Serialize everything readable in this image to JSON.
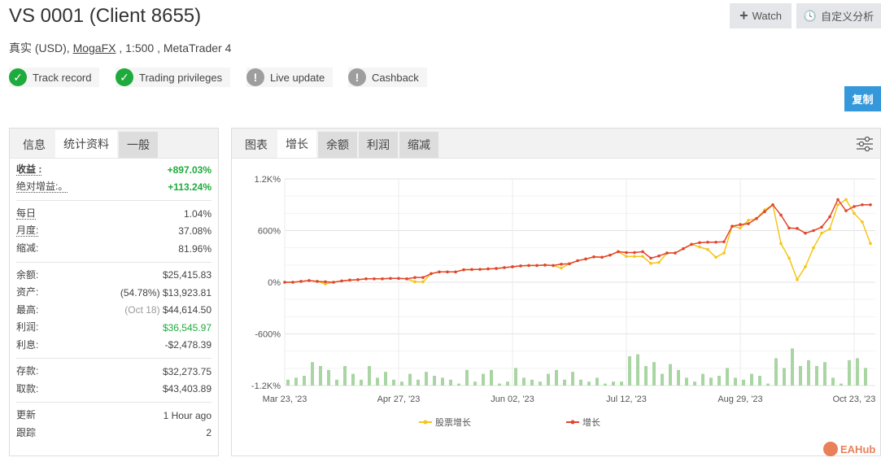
{
  "header": {
    "title": "VS 0001 (Client 8655)",
    "account_type": "真实 (USD),",
    "broker": "MogaFX",
    "leverage": ", 1:500 , MetaTrader 4",
    "watch_label": "Watch",
    "custom_label": "自定义分析",
    "copy_label": "复制"
  },
  "badges": [
    {
      "label": "Track record",
      "status": "ok"
    },
    {
      "label": "Trading privileges",
      "status": "ok"
    },
    {
      "label": "Live update",
      "status": "warn"
    },
    {
      "label": "Cashback",
      "status": "warn"
    }
  ],
  "left_tabs": [
    "信息",
    "统计资料",
    "一般"
  ],
  "stats": {
    "gain": {
      "label": "收益 :",
      "value": "+897.03%"
    },
    "abs_gain": {
      "label": "绝对增益:。",
      "value": "+113.24%"
    },
    "daily": {
      "label": "每日",
      "value": "1.04%"
    },
    "monthly": {
      "label": "月度:",
      "value": "37.08%"
    },
    "drawdown": {
      "label": "缩减:",
      "value": "81.96%"
    },
    "balance": {
      "label": "余额:",
      "value": "$25,415.83"
    },
    "equity": {
      "label": "资产:",
      "note": "(54.78%)",
      "value": "$13,923.81"
    },
    "highest": {
      "label": "最高:",
      "note": "(Oct 18)",
      "value": "$44,614.50"
    },
    "profit": {
      "label": "利润:",
      "value": "$36,545.97"
    },
    "interest": {
      "label": "利息:",
      "value": "-$2,478.39"
    },
    "deposits": {
      "label": "存款:",
      "value": "$32,273.75"
    },
    "withdrawals": {
      "label": "取款:",
      "value": "$43,403.89"
    },
    "updated": {
      "label": "更新",
      "value": "1 Hour ago"
    },
    "tracking": {
      "label": "跟踪",
      "value": "2"
    }
  },
  "chart_tabs": [
    "图表",
    "增长",
    "余额",
    "利润",
    "缩减"
  ],
  "watermark": "EAHub",
  "chart_data": {
    "type": "line",
    "x_tick_labels": [
      "Mar 23, '23",
      "Apr 27, '23",
      "Jun 02, '23",
      "Jul 12, '23",
      "Aug 29, '23",
      "Oct 23, '23"
    ],
    "x_tick_index": [
      0,
      14,
      28,
      42,
      56,
      70
    ],
    "y_ticks": [
      -1200,
      -600,
      0,
      600,
      1200
    ],
    "y_tick_labels": [
      "-1.2K%",
      "-600%",
      "0%",
      "600%",
      "1.2K%"
    ],
    "ylim": [
      -1200,
      1200
    ],
    "grid": true,
    "legend_position": "bottom",
    "series": [
      {
        "name": "股票增长",
        "color": "#f5c518",
        "values": [
          0,
          0,
          10,
          20,
          10,
          -20,
          0,
          15,
          25,
          30,
          40,
          40,
          40,
          45,
          45,
          40,
          5,
          5,
          100,
          120,
          120,
          120,
          145,
          148,
          150,
          155,
          160,
          170,
          180,
          190,
          195,
          195,
          200,
          195,
          165,
          215,
          250,
          270,
          295,
          290,
          315,
          355,
          300,
          300,
          300,
          220,
          230,
          340,
          340,
          390,
          440,
          410,
          380,
          290,
          340,
          650,
          630,
          720,
          740,
          840,
          900,
          450,
          280,
          30,
          180,
          400,
          570,
          620,
          900,
          960,
          800,
          700,
          450
        ]
      },
      {
        "name": "增长",
        "color": "#e0452e",
        "values": [
          0,
          0,
          10,
          20,
          10,
          5,
          0,
          15,
          25,
          30,
          40,
          40,
          40,
          45,
          45,
          40,
          55,
          55,
          100,
          120,
          120,
          120,
          145,
          148,
          150,
          155,
          160,
          170,
          180,
          190,
          195,
          195,
          200,
          195,
          210,
          215,
          250,
          270,
          295,
          290,
          315,
          355,
          345,
          345,
          355,
          280,
          305,
          340,
          340,
          390,
          440,
          460,
          465,
          465,
          470,
          650,
          670,
          680,
          740,
          820,
          900,
          780,
          630,
          625,
          570,
          600,
          640,
          760,
          960,
          830,
          880,
          900,
          900
        ]
      }
    ],
    "bars": [
      3,
      4,
      5,
      12,
      10,
      8,
      3,
      10,
      6,
      3,
      10,
      4,
      7,
      3,
      2,
      6,
      3,
      7,
      5,
      4,
      3,
      1,
      8,
      2,
      6,
      8,
      1,
      2,
      9,
      4,
      3,
      2,
      6,
      8,
      3,
      7,
      3,
      2,
      4,
      1,
      2,
      2,
      15,
      16,
      10,
      12,
      6,
      11,
      8,
      4,
      2,
      6,
      4,
      5,
      9,
      4,
      3,
      6,
      5,
      1,
      14,
      9,
      19,
      10,
      13,
      10,
      12,
      4,
      1,
      13,
      14,
      9
    ]
  }
}
